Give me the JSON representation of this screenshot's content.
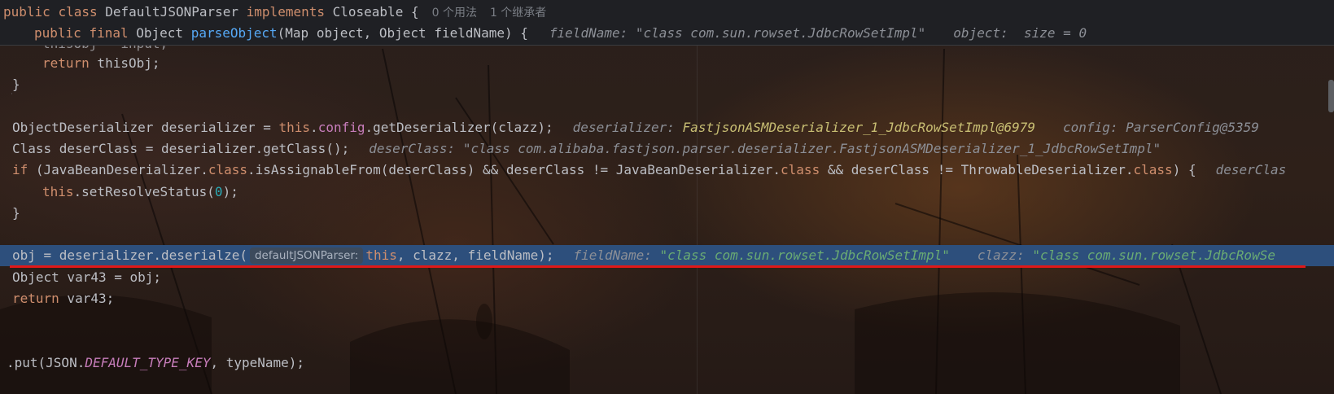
{
  "header": {
    "class_decl": {
      "kw_public": "public",
      "kw_class": "class",
      "name": "DefaultJSONParser",
      "kw_implements": "implements",
      "iface": "Closeable {",
      "usages": "0 个用法",
      "inheritors": "1 个继承者"
    },
    "method_decl": {
      "kw_public": "public",
      "kw_final": "final",
      "type": "Object",
      "name": "parseObject",
      "params": "(Map object, Object fieldName) {",
      "hint_fieldName_label": "fieldName:",
      "hint_fieldName_value": "\"class com.sun.rowset.JdbcRowSetImpl\"",
      "hint_object_label": "object:",
      "hint_object_value": " size = 0"
    }
  },
  "code": {
    "l0_partial": "thisObj = input;",
    "l1": {
      "kw": "return",
      "rest": " thisObj;"
    },
    "l2": "}",
    "l4": {
      "a": "ObjectDeserializer deserializer = ",
      "this": "this",
      "dot": ".",
      "field": "config",
      "b": ".getDeserializer(clazz);",
      "h1_label": "deserializer:",
      "h1_value": "FastjsonASMDeserializer_1_JdbcRowSetImpl@6979",
      "h2_label": "config:",
      "h2_value": "ParserConfig@5359"
    },
    "l5": {
      "a": "Class deserClass = deserializer.getClass();",
      "h_label": "deserClass:",
      "h_value": "\"class com.alibaba.fastjson.parser.deserializer.FastjsonASMDeserializer_1_JdbcRowSetImpl\""
    },
    "l6": {
      "kw_if": "if",
      "a": " (JavaBeanDeserializer.",
      "kw_class1": "class",
      "b": ".isAssignableFrom(deserClass) && deserClass != JavaBeanDeserializer.",
      "kw_class2": "class",
      "c": " && deserClass != ThrowableDeserializer.",
      "kw_class3": "class",
      "d": ") {",
      "h_label": "deserClas"
    },
    "l7": {
      "kw_this": "this",
      "a": ".setResolveStatus(",
      "num": "0",
      "b": ");"
    },
    "l8": "}",
    "l10": {
      "a": "obj = deserializer.deserialze(",
      "param_hint": "defaultJSONParser:",
      "kw_this": "this",
      "b": ", clazz, fieldName);",
      "h1_label": "fieldName:",
      "h1_value": "\"class com.sun.rowset.JdbcRowSetImpl\"",
      "h2_label": "clazz:",
      "h2_value": "\"class com.sun.rowset.JdbcRowSe"
    },
    "l11": "Object var43 = obj;",
    "l12": {
      "kw": "return",
      "rest": " var43;"
    },
    "l14": {
      "a": ".put(JSON.",
      "const": "DEFAULT_TYPE_KEY",
      "b": ", typeName);"
    }
  },
  "colors": {
    "keyword": "#cf8e6d",
    "method": "#56a8f5",
    "field": "#c77dbb",
    "number": "#2aacb8",
    "execution_line": "#2d4f7c",
    "underline": "#e01818"
  }
}
